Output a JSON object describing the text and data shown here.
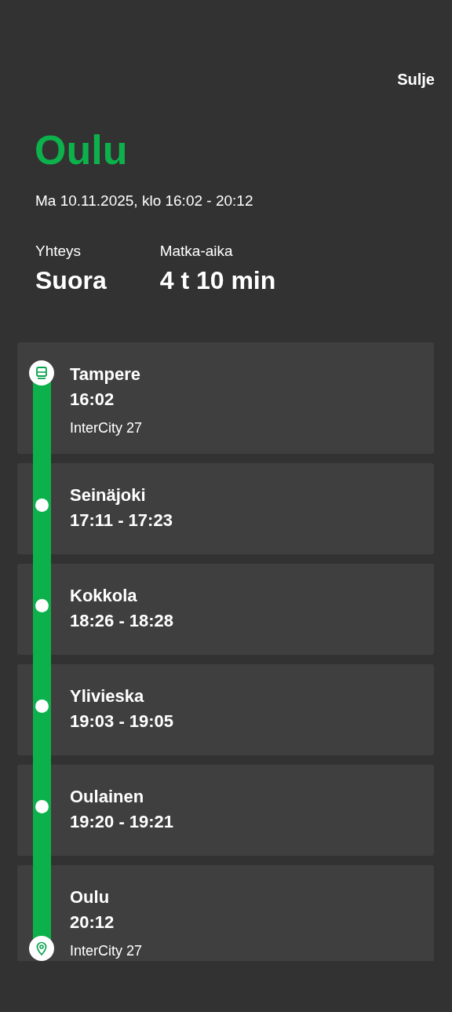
{
  "close_button": "Sulje",
  "route": {
    "to": "Oulu",
    "date": "Ma 10.11.2025, klo 16:02 - 20:12"
  },
  "summary": [
    {
      "label": "Yhteys",
      "value": "Suora"
    },
    {
      "label": "Matka-aika",
      "value": "4 t 10 min"
    }
  ],
  "stops": [
    {
      "kind": "origin",
      "name": "Tampere",
      "time": "16:02",
      "train": "InterCity 27"
    },
    {
      "kind": "stop",
      "name": "Seinäjoki",
      "time": "17:11 - 17:23"
    },
    {
      "kind": "stop",
      "name": "Kokkola",
      "time": "18:26 - 18:28"
    },
    {
      "kind": "stop",
      "name": "Ylivieska",
      "time": "19:03 - 19:05"
    },
    {
      "kind": "stop",
      "name": "Oulainen",
      "time": "19:20 - 19:21"
    },
    {
      "kind": "destination",
      "name": "Oulu",
      "time": "20:12",
      "train": "InterCity 27"
    }
  ]
}
